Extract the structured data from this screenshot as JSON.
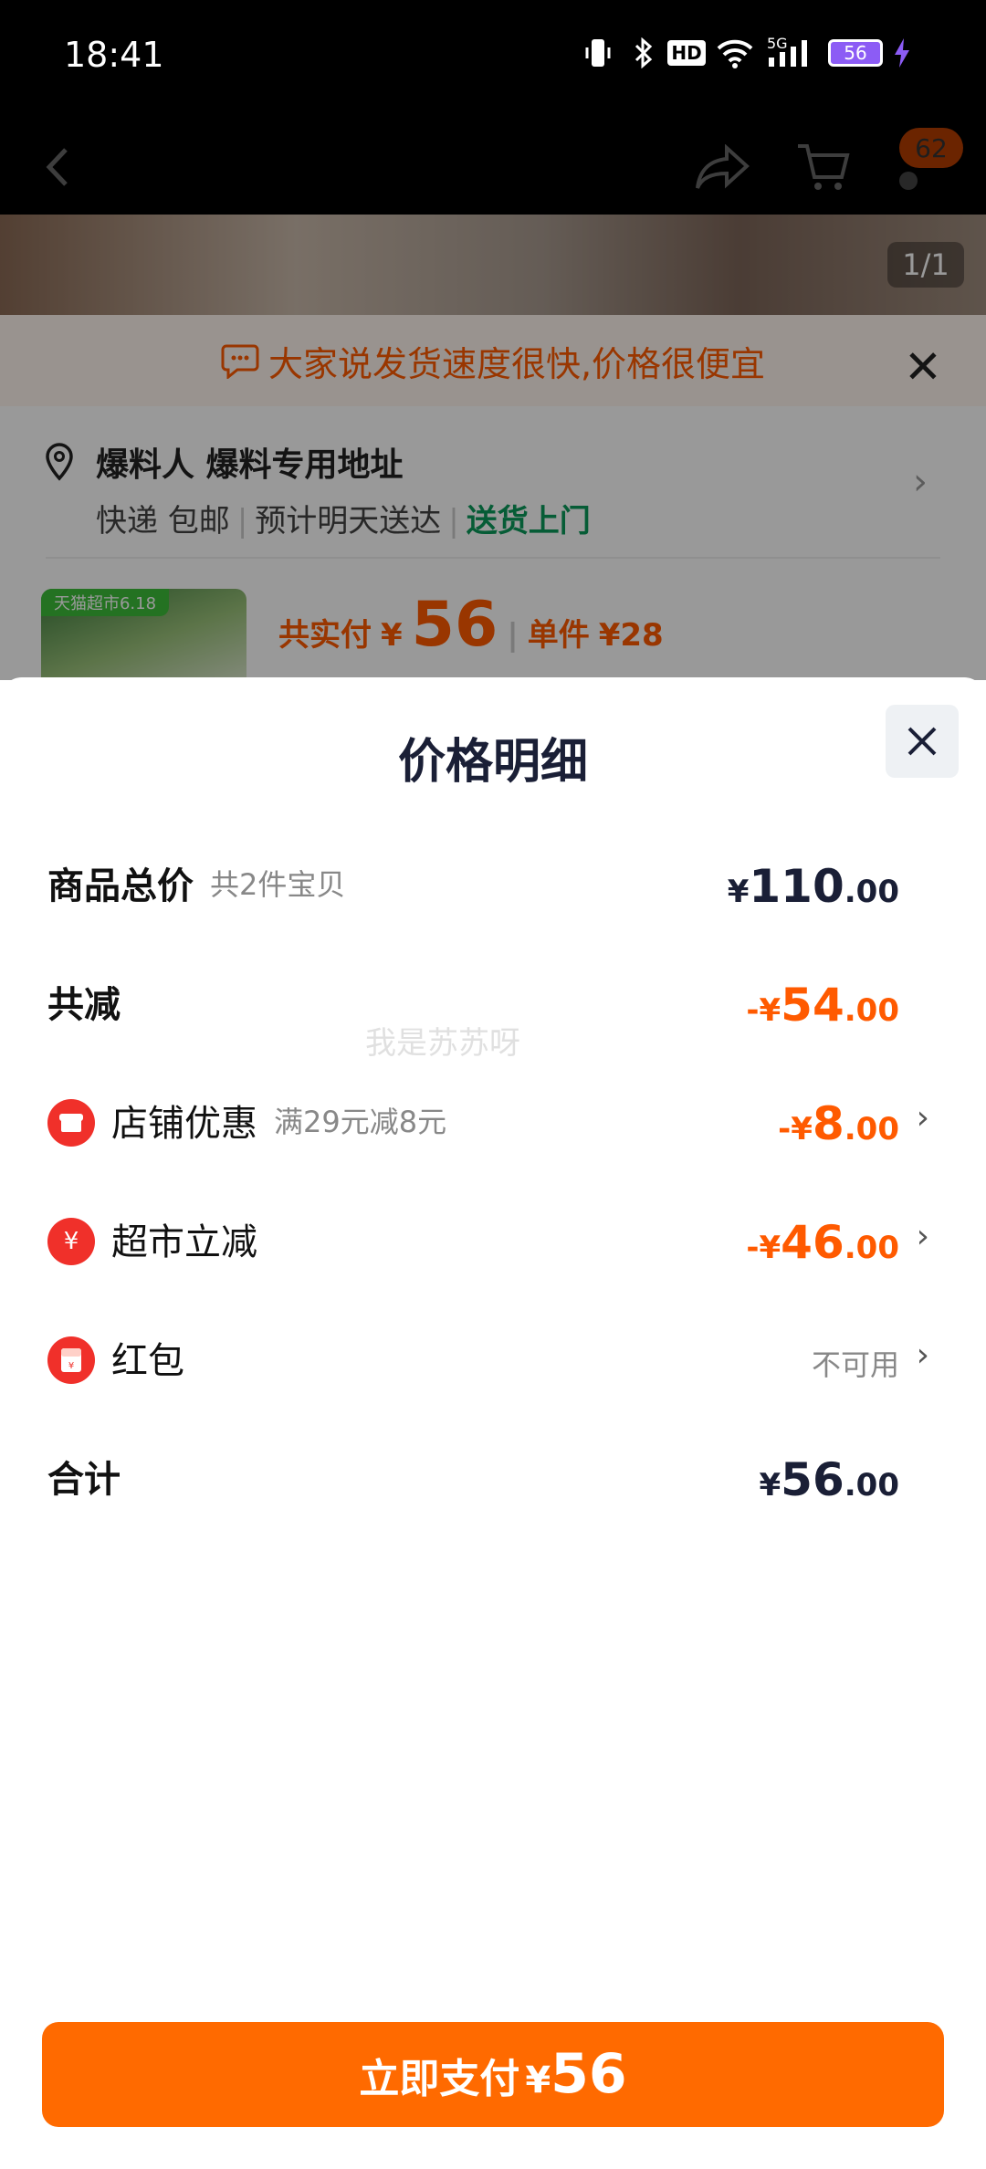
{
  "status_bar": {
    "time": "18:41",
    "battery": "56",
    "network": "5G",
    "hd": "HD"
  },
  "nav": {
    "cart_badge": "62"
  },
  "gallery": {
    "counter": "1/1"
  },
  "product_card": {
    "notice": "大家说发货速度很快,价格很便宜",
    "address_name": "爆料人 爆料专用地址",
    "delivery_method": "快递 包邮",
    "eta": "预计明天送达",
    "door_delivery": "送货上门",
    "thumb_tag": "天猫超市6.18",
    "pay_label": "共实付",
    "pay_currency": "¥",
    "pay_amount": "56",
    "unit_price_label": "单件",
    "unit_price": "¥28"
  },
  "sheet": {
    "title": "价格明细",
    "rows": [
      {
        "label": "商品总价",
        "sub": "共2件宝贝",
        "prefix": "",
        "yen": "¥",
        "int": "110",
        "dec": ".00"
      },
      {
        "label": "共减",
        "sub": "",
        "prefix": "-",
        "yen": "¥",
        "int": "54",
        "dec": ".00"
      },
      {
        "label": "店铺优惠",
        "sub": "满29元减8元",
        "prefix": "-",
        "yen": "¥",
        "int": "8",
        "dec": ".00"
      },
      {
        "label": "超市立减",
        "sub": "",
        "prefix": "-",
        "yen": "¥",
        "int": "46",
        "dec": ".00"
      },
      {
        "label": "红包",
        "sub": "",
        "status": "不可用"
      },
      {
        "label": "合计",
        "sub": "",
        "prefix": "",
        "yen": "¥",
        "int": "56",
        "dec": ".00"
      }
    ],
    "watermark": "我是苏苏呀"
  },
  "pay_button": {
    "label": "立即支付",
    "yen": "¥",
    "amount": "56"
  },
  "colors": {
    "accent": "#ff6a00",
    "discount": "#ff5a00",
    "green": "#0a9a5a",
    "badge_red": "#f0302a"
  }
}
